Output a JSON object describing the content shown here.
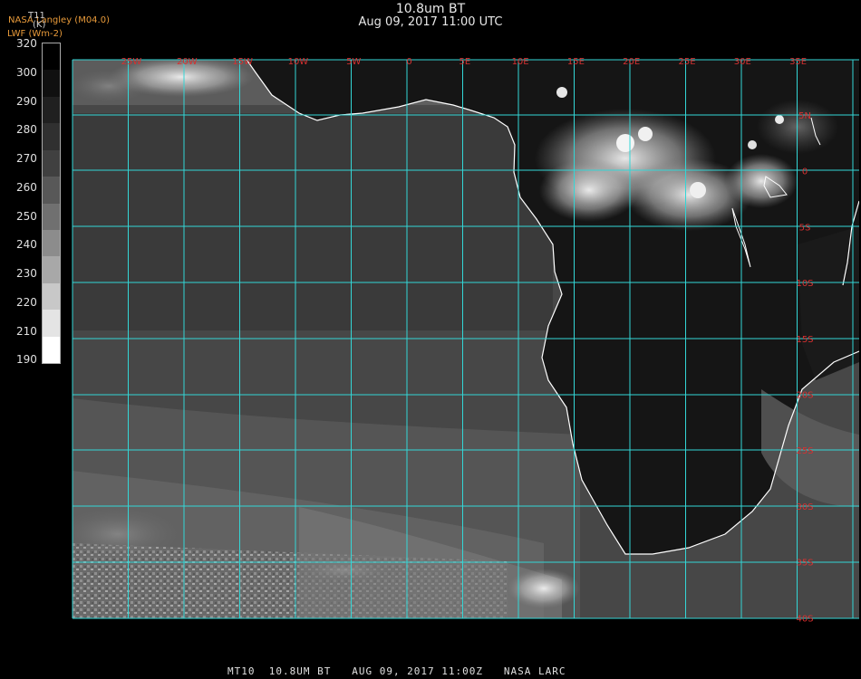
{
  "header": {
    "title": "10.8um BT",
    "datetime": "Aug 09, 2017 11:00 UTC"
  },
  "corner_labels": {
    "variable": "T11",
    "organization": "NASA Langley (M04.0)",
    "unit": "(K)",
    "product": "LWF (Wm-2)"
  },
  "colorbar": {
    "ticks": [
      "320",
      "300",
      "290",
      "280",
      "270",
      "260",
      "250",
      "240",
      "230",
      "220",
      "210",
      "190"
    ],
    "colors": [
      "#000000",
      "#101010",
      "#202020",
      "#303030",
      "#404040",
      "#585858",
      "#707070",
      "#8c8c8c",
      "#a8a8a8",
      "#c8c8c8",
      "#e4e4e4",
      "#ffffff"
    ]
  },
  "map": {
    "region": "Southern Africa and South Atlantic",
    "grid_color": "#33d6d6",
    "label_color": "#d83030",
    "coast_color": "#ffffff",
    "lon_labels": [
      "25W",
      "20W",
      "15W",
      "10W",
      "5W",
      "0",
      "5E",
      "10E",
      "15E",
      "20E",
      "25E",
      "30E",
      "35E"
    ],
    "lat_labels": [
      "5N",
      "0",
      "5S",
      "10S",
      "15S",
      "20S",
      "25S",
      "30S",
      "35S",
      "40S"
    ]
  },
  "footer": {
    "text": "MT10  10.8UM BT   AUG 09, 2017 11:00Z   NASA LARC"
  }
}
